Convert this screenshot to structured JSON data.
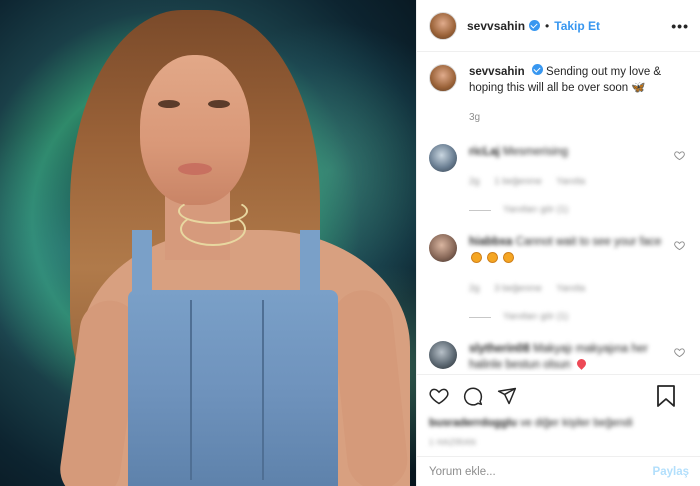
{
  "header": {
    "username": "sevvsahin",
    "separator": "•",
    "follow_label": "Takip Et",
    "more_label": "•••"
  },
  "caption": {
    "username": "sevvsahin",
    "text": "Sending out my love & hoping this will all be over soon 🦋",
    "time": "3g"
  },
  "comments": [
    {
      "username": "ricLaj",
      "text": "Mesmerising",
      "time": "2g",
      "likes": "1 beğenme",
      "reply": "Yanıtla",
      "thread": "Yanıtları gör (1)"
    },
    {
      "username": "hiabbxa",
      "text": "Cannot wait to see your face",
      "time": "2g",
      "likes": "3 beğenme",
      "reply": "Yanıtla",
      "thread": "Yanıtları gör (1)"
    },
    {
      "username": "slytherin08",
      "text": "Makyajı makyajına her halinle bestun olsun"
    }
  ],
  "likes": {
    "user": "busraderrdogglu",
    "suffix": "ve diğer kişiler beğendi"
  },
  "date": "1 HAZİRAN",
  "add_comment": {
    "placeholder": "Yorum ekle...",
    "post_label": "Paylaş"
  },
  "colors": {
    "accent": "#3897f0",
    "post_disabled": "#b2dffc",
    "muted": "#8e8e8e"
  }
}
